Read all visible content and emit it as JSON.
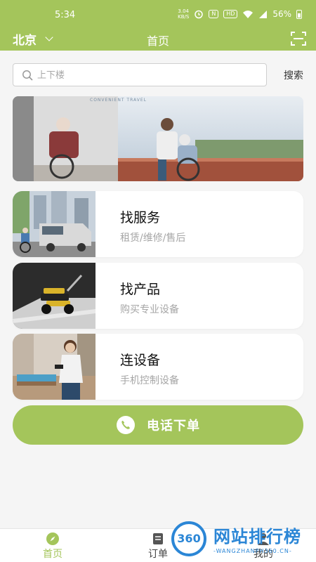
{
  "status_bar": {
    "time": "5:34",
    "net_speed": "3.04",
    "net_unit": "KB/S",
    "battery": "56%"
  },
  "header": {
    "city": "北京",
    "title": "首页",
    "colors": {
      "accent": "#a4c55b"
    }
  },
  "search": {
    "placeholder": "上下楼",
    "button_label": "搜索"
  },
  "banner": {
    "caption": "CONVENIENT TRAVEL"
  },
  "cards": [
    {
      "title": "找服务",
      "subtitle": "租赁/维修/售后",
      "image": "van-wheelchair-photo"
    },
    {
      "title": "找产品",
      "subtitle": "购买专业设备",
      "image": "stair-climber-photo"
    },
    {
      "title": "连设备",
      "subtitle": "手机控制设备",
      "image": "caregiver-photo"
    }
  ],
  "call_button": {
    "label": "电话下单",
    "icon": "phone-icon"
  },
  "tabs": [
    {
      "label": "首页",
      "icon": "compass-icon",
      "active": true
    },
    {
      "label": "订单",
      "icon": "order-icon",
      "active": false
    },
    {
      "label": "我的",
      "icon": "user-icon",
      "active": false
    }
  ],
  "watermark": {
    "logo_text": "360",
    "title": "网站排行榜",
    "subtitle": "-WANGZHANPH360.CN-"
  }
}
